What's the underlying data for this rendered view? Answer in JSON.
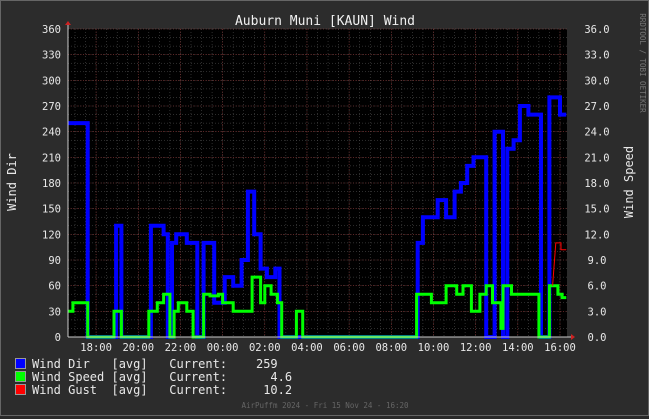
{
  "chart_data": {
    "type": "line",
    "title": "Auburn Muni [KAUN] Wind",
    "ylabel_left": "Wind Dir",
    "ylabel_right": "Wind Speed",
    "side_credit": "RRDTOOL / TOBI OETIKER",
    "footer": "AirPuffm 2024 - Fri 15 Nov 24 - 16:20",
    "x_ticks": [
      "18:00",
      "20:00",
      "22:00",
      "00:00",
      "02:00",
      "04:00",
      "06:00",
      "08:00",
      "10:00",
      "12:00",
      "14:00",
      "16:00"
    ],
    "x_range": [
      "16:40",
      "16:20"
    ],
    "ylim_left": [
      0,
      360
    ],
    "ylim_right": [
      0,
      36
    ],
    "y_ticks_left": [
      "0",
      "30",
      "60",
      "90",
      "120",
      "150",
      "180",
      "210",
      "240",
      "270",
      "300",
      "330",
      "360"
    ],
    "y_ticks_right": [
      "0.0",
      "3.0",
      "6.0",
      "9.0",
      "12.0",
      "15.0",
      "18.0",
      "21.0",
      "24.0",
      "27.0",
      "30.0",
      "33.0",
      "36.0"
    ],
    "grid": true,
    "series": [
      {
        "name": "Wind Dir",
        "axis": "left",
        "color": "#0000ff",
        "points_hours": [
          [
            -1.33,
            250
          ],
          [
            -0.4,
            250
          ],
          [
            -0.4,
            0
          ],
          [
            0.95,
            0
          ],
          [
            0.95,
            130
          ],
          [
            1.2,
            130
          ],
          [
            1.2,
            0
          ],
          [
            2.6,
            0
          ],
          [
            2.6,
            130
          ],
          [
            3.2,
            130
          ],
          [
            3.2,
            120
          ],
          [
            3.4,
            120
          ],
          [
            3.4,
            0
          ],
          [
            3.6,
            0
          ],
          [
            3.6,
            110
          ],
          [
            3.8,
            110
          ],
          [
            3.8,
            120
          ],
          [
            4.3,
            120
          ],
          [
            4.3,
            110
          ],
          [
            4.8,
            110
          ],
          [
            4.8,
            0
          ],
          [
            5.1,
            0
          ],
          [
            5.1,
            110
          ],
          [
            5.6,
            110
          ],
          [
            5.6,
            40
          ],
          [
            6.1,
            40
          ],
          [
            6.1,
            70
          ],
          [
            6.5,
            70
          ],
          [
            6.5,
            60
          ],
          [
            6.9,
            60
          ],
          [
            6.9,
            90
          ],
          [
            7.2,
            90
          ],
          [
            7.2,
            170
          ],
          [
            7.5,
            170
          ],
          [
            7.5,
            120
          ],
          [
            7.8,
            120
          ],
          [
            7.8,
            80
          ],
          [
            8.1,
            80
          ],
          [
            8.1,
            70
          ],
          [
            8.5,
            70
          ],
          [
            8.5,
            80
          ],
          [
            8.7,
            80
          ],
          [
            8.7,
            0
          ],
          [
            15.25,
            0
          ],
          [
            15.25,
            110
          ],
          [
            15.5,
            110
          ],
          [
            15.5,
            140
          ],
          [
            16.2,
            140
          ],
          [
            16.2,
            160
          ],
          [
            16.6,
            160
          ],
          [
            16.6,
            140
          ],
          [
            17.0,
            140
          ],
          [
            17.0,
            170
          ],
          [
            17.3,
            170
          ],
          [
            17.3,
            180
          ],
          [
            17.6,
            180
          ],
          [
            17.6,
            200
          ],
          [
            17.9,
            200
          ],
          [
            17.9,
            210
          ],
          [
            18.5,
            210
          ],
          [
            18.5,
            0
          ],
          [
            18.9,
            0
          ],
          [
            18.9,
            240
          ],
          [
            19.3,
            240
          ],
          [
            19.3,
            0
          ],
          [
            19.5,
            0
          ],
          [
            19.5,
            220
          ],
          [
            19.8,
            220
          ],
          [
            19.8,
            230
          ],
          [
            20.1,
            230
          ],
          [
            20.1,
            270
          ],
          [
            20.5,
            270
          ],
          [
            20.5,
            260
          ],
          [
            21.1,
            260
          ],
          [
            21.1,
            0
          ],
          [
            21.5,
            0
          ],
          [
            21.5,
            280
          ],
          [
            22.0,
            280
          ],
          [
            22.0,
            260
          ],
          [
            22.3,
            260
          ]
        ]
      },
      {
        "name": "Wind Speed",
        "axis": "right",
        "color": "#00ff00",
        "points_hours": [
          [
            -1.33,
            3
          ],
          [
            -1.1,
            3
          ],
          [
            -1.1,
            4
          ],
          [
            -0.4,
            4
          ],
          [
            -0.4,
            0
          ],
          [
            0.85,
            0
          ],
          [
            0.85,
            3
          ],
          [
            1.2,
            3
          ],
          [
            1.2,
            0
          ],
          [
            2.5,
            0
          ],
          [
            2.5,
            3
          ],
          [
            2.9,
            3
          ],
          [
            2.9,
            4
          ],
          [
            3.2,
            4
          ],
          [
            3.2,
            5
          ],
          [
            3.5,
            5
          ],
          [
            3.5,
            0
          ],
          [
            3.7,
            0
          ],
          [
            3.7,
            3
          ],
          [
            3.9,
            3
          ],
          [
            3.9,
            4
          ],
          [
            4.3,
            4
          ],
          [
            4.3,
            3
          ],
          [
            4.6,
            3
          ],
          [
            4.6,
            0
          ],
          [
            5.1,
            0
          ],
          [
            5.1,
            5
          ],
          [
            5.4,
            5
          ],
          [
            5.4,
            4.8
          ],
          [
            5.8,
            4.8
          ],
          [
            5.8,
            5
          ],
          [
            6.0,
            5
          ],
          [
            6.0,
            4
          ],
          [
            6.5,
            4
          ],
          [
            6.5,
            3
          ],
          [
            7.4,
            3
          ],
          [
            7.4,
            7
          ],
          [
            7.8,
            7
          ],
          [
            7.8,
            4
          ],
          [
            8.0,
            4
          ],
          [
            8.0,
            6
          ],
          [
            8.3,
            6
          ],
          [
            8.3,
            5
          ],
          [
            8.6,
            5
          ],
          [
            8.6,
            4
          ],
          [
            8.8,
            4
          ],
          [
            8.8,
            0
          ],
          [
            9.5,
            0
          ],
          [
            9.5,
            3
          ],
          [
            9.8,
            3
          ],
          [
            9.8,
            0
          ],
          [
            15.2,
            0
          ],
          [
            15.2,
            5
          ],
          [
            15.9,
            5
          ],
          [
            15.9,
            4
          ],
          [
            16.6,
            4
          ],
          [
            16.6,
            6
          ],
          [
            17.1,
            6
          ],
          [
            17.1,
            5
          ],
          [
            17.4,
            5
          ],
          [
            17.4,
            6
          ],
          [
            17.8,
            6
          ],
          [
            17.8,
            3
          ],
          [
            18.2,
            3
          ],
          [
            18.2,
            5
          ],
          [
            18.5,
            5
          ],
          [
            18.5,
            6
          ],
          [
            18.8,
            6
          ],
          [
            18.8,
            4
          ],
          [
            19.2,
            4
          ],
          [
            19.2,
            1
          ],
          [
            19.3,
            1
          ],
          [
            19.3,
            6
          ],
          [
            19.7,
            6
          ],
          [
            19.7,
            5
          ],
          [
            21.0,
            5
          ],
          [
            21.0,
            0
          ],
          [
            21.5,
            0
          ],
          [
            21.5,
            6
          ],
          [
            21.9,
            6
          ],
          [
            21.9,
            5
          ],
          [
            22.1,
            5
          ],
          [
            22.1,
            4.6
          ],
          [
            22.3,
            4.6
          ]
        ]
      },
      {
        "name": "Wind Gust",
        "axis": "right",
        "color": "#ff0000",
        "points_hours": [
          [
            21.65,
            6
          ],
          [
            21.8,
            11
          ],
          [
            22.05,
            11
          ],
          [
            22.05,
            10.2
          ],
          [
            22.3,
            10.2
          ]
        ]
      }
    ],
    "legend": [
      {
        "swatch": "#0000ff",
        "text": "Wind Dir   [avg]   Current:    259"
      },
      {
        "swatch": "#00ff00",
        "text": "Wind Speed [avg]   Current:      4.6"
      },
      {
        "swatch": "#ff0000",
        "text": "Wind Gust  [avg]   Current:     10.2"
      }
    ]
  }
}
